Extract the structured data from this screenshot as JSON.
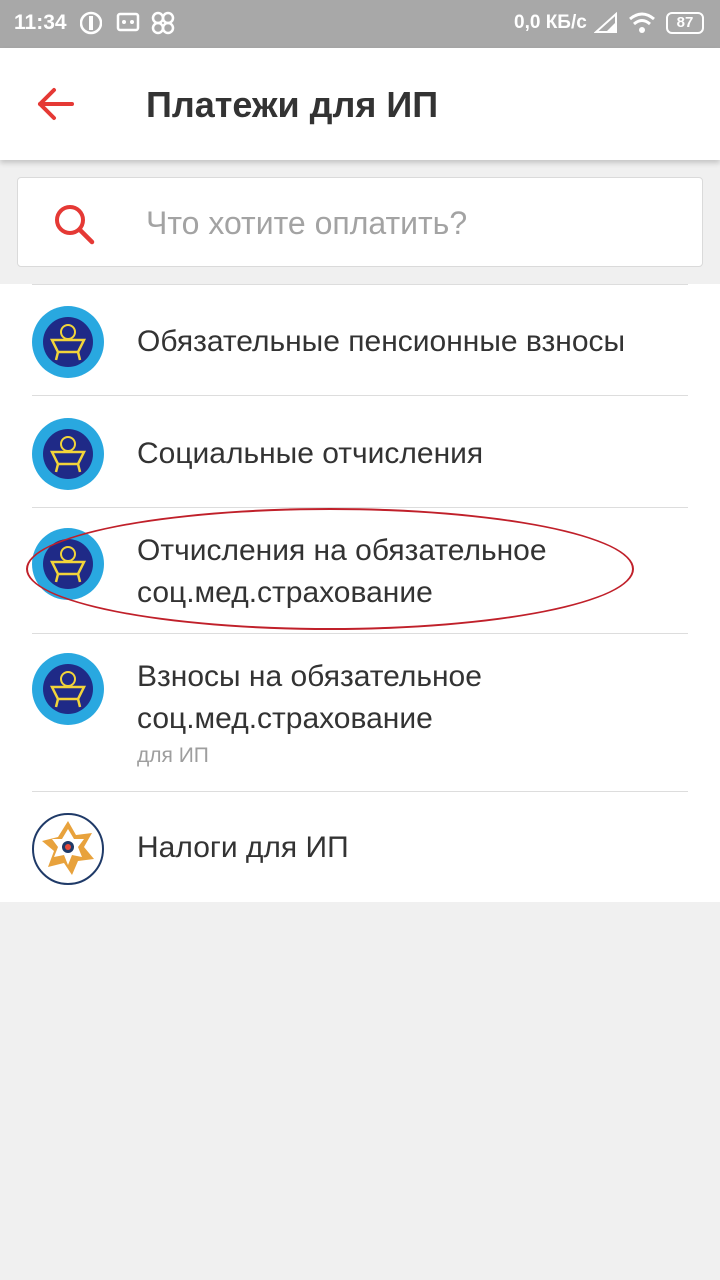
{
  "status_bar": {
    "time": "11:34",
    "network_speed": "0,0 КБ/с",
    "battery": "87"
  },
  "header": {
    "title": "Платежи для ИП",
    "back_icon": "arrow-left-icon"
  },
  "search": {
    "placeholder": "Что хотите оплатить?",
    "value": ""
  },
  "items": [
    {
      "label": "Обязательные пенсионные взносы",
      "logo": "enpf-logo"
    },
    {
      "label": "Социальные отчисления",
      "logo": "enpf-logo"
    },
    {
      "label_line1": "Отчисления на обязательное",
      "label_line2": "соц.мед.страхование",
      "logo": "enpf-logo",
      "highlighted": true
    },
    {
      "label_line1": "Взносы на обязательное",
      "label_line2": "соц.мед.страхование",
      "sublabel": "для ИП",
      "logo": "enpf-logo"
    },
    {
      "label": "Налоги для ИП",
      "logo": "tax-committee-logo"
    }
  ],
  "colors": {
    "accent": "#e53935",
    "status_bar": "#a8a8a8",
    "logo_blue": "#29a8e0",
    "logo_navy": "#1f2a87",
    "highlight": "#c0202a"
  }
}
